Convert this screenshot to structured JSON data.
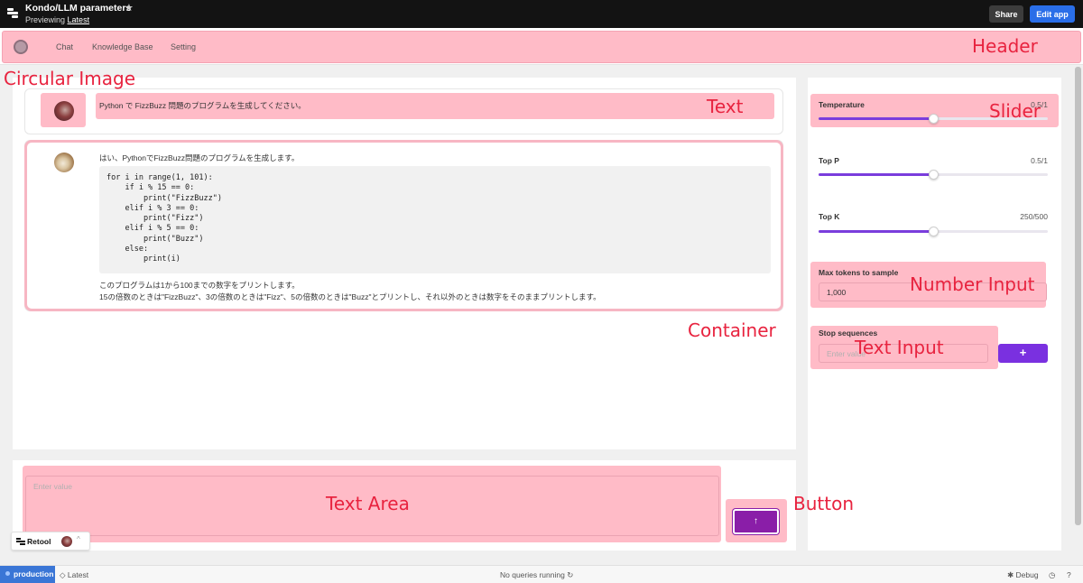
{
  "topbar": {
    "title": "Kondo/LLM parameters",
    "preview_prefix": "Previewing",
    "preview_link": "Latest",
    "share_label": "Share",
    "edit_label": "Edit app"
  },
  "header": {
    "nav": [
      "Chat",
      "Knowledge Base",
      "Setting"
    ]
  },
  "chat": {
    "user_message": "Python で FizzBuzz 問題のプログラムを生成してください。",
    "bot_intro": "はい、PythonでFizzBuzz問題のプログラムを生成します。",
    "code": "for i in range(1, 101):\n    if i % 15 == 0:\n        print(\"FizzBuzz\")\n    elif i % 3 == 0:\n        print(\"Fizz\")\n    elif i % 5 == 0:\n        print(\"Buzz\")\n    else:\n        print(i)",
    "bot_outro_1": "このプログラムは1から100までの数字をプリントします。",
    "bot_outro_2": "15の倍数のときは\"FizzBuzz\"、3の倍数のときは\"Fizz\"、5の倍数のときは\"Buzz\"とプリントし、それ以外のときは数字をそのままプリントします。"
  },
  "composer": {
    "placeholder": "Enter value",
    "send_icon": "arrow-up-icon"
  },
  "parameters": {
    "temperature": {
      "label": "Temperature",
      "value_text": "0.5/1",
      "fraction": 0.5
    },
    "top_p": {
      "label": "Top P",
      "value_text": "0.5/1",
      "fraction": 0.5
    },
    "top_k": {
      "label": "Top K",
      "value_text": "250/500",
      "fraction": 0.5
    },
    "max_tokens": {
      "label": "Max tokens to sample",
      "value": "1,000"
    },
    "stop_sequences": {
      "label": "Stop sequences",
      "placeholder": "Enter value",
      "add_label": "+"
    }
  },
  "annotations": {
    "header": "Header",
    "circular_image": "Circular Image",
    "text": "Text",
    "slider": "Slider",
    "number_input": "Number Input",
    "text_input": "Text Input",
    "container": "Container",
    "text_area": "Text Area",
    "button": "Button"
  },
  "retool_badge": {
    "label": "Retool",
    "caret": "^"
  },
  "statusbar": {
    "env": "production",
    "version": "Latest",
    "queries": "No queries running",
    "debug": "Debug"
  },
  "colors": {
    "accent_purple": "#7a3ddc",
    "annotation_red": "#e8233f",
    "highlight_pink": "#ffaab9",
    "edit_blue": "#2a6ee8",
    "env_blue": "#3a76d6"
  }
}
